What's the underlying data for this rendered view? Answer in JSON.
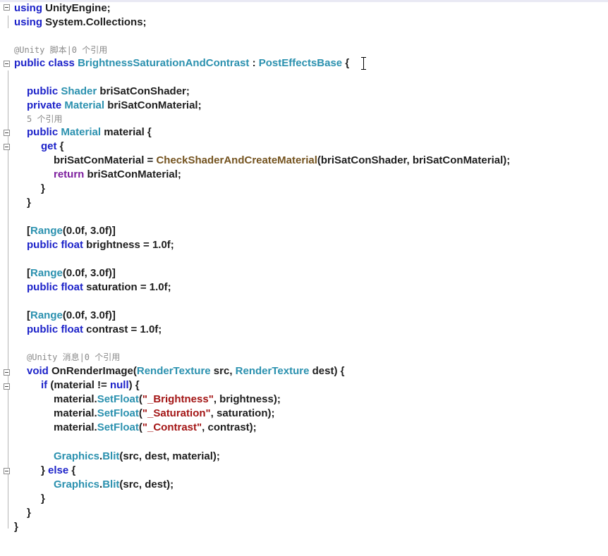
{
  "editor": {
    "lines": [
      {
        "id": "l1",
        "tokens": [
          [
            "k",
            "using"
          ],
          [
            "n",
            " UnityEngine;"
          ]
        ]
      },
      {
        "id": "l2",
        "tokens": [
          [
            "k",
            "using"
          ],
          [
            "n",
            " System.Collections;"
          ]
        ]
      },
      {
        "id": "lens1",
        "lens": "@Unity 脚本|0 个引用"
      },
      {
        "id": "l3",
        "tokens": [
          [
            "k",
            "public"
          ],
          [
            "n",
            " "
          ],
          [
            "k",
            "class"
          ],
          [
            "n",
            " "
          ],
          [
            "t",
            "BrightnessSaturationAndContrast"
          ],
          [
            "n",
            " : "
          ],
          [
            "t",
            "PostEffectsBase"
          ],
          [
            "n",
            " {"
          ]
        ]
      },
      {
        "id": "l4",
        "tokens": [
          [
            "k",
            "public"
          ],
          [
            "n",
            " "
          ],
          [
            "t",
            "Shader"
          ],
          [
            "n",
            " briSatConShader;"
          ]
        ]
      },
      {
        "id": "l5",
        "tokens": [
          [
            "k",
            "private"
          ],
          [
            "n",
            " "
          ],
          [
            "t",
            "Material"
          ],
          [
            "n",
            " briSatConMaterial;"
          ]
        ]
      },
      {
        "id": "lens2",
        "lens": "5 个引用"
      },
      {
        "id": "l6",
        "tokens": [
          [
            "k",
            "public"
          ],
          [
            "n",
            " "
          ],
          [
            "t",
            "Material"
          ],
          [
            "n",
            " material {"
          ]
        ]
      },
      {
        "id": "l7",
        "tokens": [
          [
            "k",
            "get"
          ],
          [
            "n",
            " {"
          ]
        ]
      },
      {
        "id": "l8",
        "tokens": [
          [
            "n",
            "briSatConMaterial = "
          ],
          [
            "m",
            "CheckShaderAndCreateMaterial"
          ],
          [
            "n",
            "(briSatConShader, briSatConMaterial);"
          ]
        ]
      },
      {
        "id": "l9",
        "tokens": [
          [
            "kp",
            "return"
          ],
          [
            "n",
            " briSatConMaterial;"
          ]
        ]
      },
      {
        "id": "l10",
        "tokens": [
          [
            "n",
            "}"
          ]
        ]
      },
      {
        "id": "l11",
        "tokens": [
          [
            "n",
            "}"
          ]
        ]
      },
      {
        "id": "l12",
        "tokens": [
          [
            "n",
            "["
          ],
          [
            "t",
            "Range"
          ],
          [
            "n",
            "(0.0f, 3.0f)]"
          ]
        ]
      },
      {
        "id": "l13",
        "tokens": [
          [
            "k",
            "public"
          ],
          [
            "n",
            " "
          ],
          [
            "k",
            "float"
          ],
          [
            "n",
            " brightness = 1.0f;"
          ]
        ]
      },
      {
        "id": "l14",
        "tokens": [
          [
            "n",
            "["
          ],
          [
            "t",
            "Range"
          ],
          [
            "n",
            "(0.0f, 3.0f)]"
          ]
        ]
      },
      {
        "id": "l15",
        "tokens": [
          [
            "k",
            "public"
          ],
          [
            "n",
            " "
          ],
          [
            "k",
            "float"
          ],
          [
            "n",
            " saturation = 1.0f;"
          ]
        ]
      },
      {
        "id": "l16",
        "tokens": [
          [
            "n",
            "["
          ],
          [
            "t",
            "Range"
          ],
          [
            "n",
            "(0.0f, 3.0f)]"
          ]
        ]
      },
      {
        "id": "l17",
        "tokens": [
          [
            "k",
            "public"
          ],
          [
            "n",
            " "
          ],
          [
            "k",
            "float"
          ],
          [
            "n",
            " contrast = 1.0f;"
          ]
        ]
      },
      {
        "id": "lens3",
        "lens": "@Unity 消息|0 个引用"
      },
      {
        "id": "l18",
        "tokens": [
          [
            "k",
            "void"
          ],
          [
            "n",
            " OnRenderImage("
          ],
          [
            "t",
            "RenderTexture"
          ],
          [
            "n",
            " src, "
          ],
          [
            "t",
            "RenderTexture"
          ],
          [
            "n",
            " dest) {"
          ]
        ]
      },
      {
        "id": "l19",
        "tokens": [
          [
            "k",
            "if"
          ],
          [
            "n",
            " (material != "
          ],
          [
            "k",
            "null"
          ],
          [
            "n",
            ") {"
          ]
        ]
      },
      {
        "id": "l20",
        "tokens": [
          [
            "n",
            "material."
          ],
          [
            "t",
            "SetFloat"
          ],
          [
            "n",
            "("
          ],
          [
            "s",
            "\"_Brightness\""
          ],
          [
            "n",
            ", brightness);"
          ]
        ]
      },
      {
        "id": "l21",
        "tokens": [
          [
            "n",
            "material."
          ],
          [
            "t",
            "SetFloat"
          ],
          [
            "n",
            "("
          ],
          [
            "s",
            "\"_Saturation\""
          ],
          [
            "n",
            ", saturation);"
          ]
        ]
      },
      {
        "id": "l22",
        "tokens": [
          [
            "n",
            "material."
          ],
          [
            "t",
            "SetFloat"
          ],
          [
            "n",
            "("
          ],
          [
            "s",
            "\"_Contrast\""
          ],
          [
            "n",
            ", contrast);"
          ]
        ]
      },
      {
        "id": "l23",
        "tokens": [
          [
            "t",
            "Graphics"
          ],
          [
            "n",
            "."
          ],
          [
            "t",
            "Blit"
          ],
          [
            "n",
            "(src, dest, material);"
          ]
        ]
      },
      {
        "id": "l24",
        "tokens": [
          [
            "n",
            "} "
          ],
          [
            "k",
            "else"
          ],
          [
            "n",
            " {"
          ]
        ]
      },
      {
        "id": "l25",
        "tokens": [
          [
            "t",
            "Graphics"
          ],
          [
            "n",
            "."
          ],
          [
            "t",
            "Blit"
          ],
          [
            "n",
            "(src, dest);"
          ]
        ]
      },
      {
        "id": "l26",
        "tokens": [
          [
            "n",
            "}"
          ]
        ]
      },
      {
        "id": "l27",
        "tokens": [
          [
            "n",
            "}"
          ]
        ]
      },
      {
        "id": "l28",
        "tokens": [
          [
            "n",
            "}"
          ]
        ]
      }
    ]
  },
  "colors": {
    "keyword": "#1c22c9",
    "keyword_control": "#7d1f9e",
    "type": "#2b91af",
    "method": "#74531f",
    "string": "#a31515",
    "text": "#1e1e1e",
    "codelens": "#8a8a8a"
  },
  "icons": [
    "fold-collapse-icon",
    "text-cursor-icon"
  ]
}
